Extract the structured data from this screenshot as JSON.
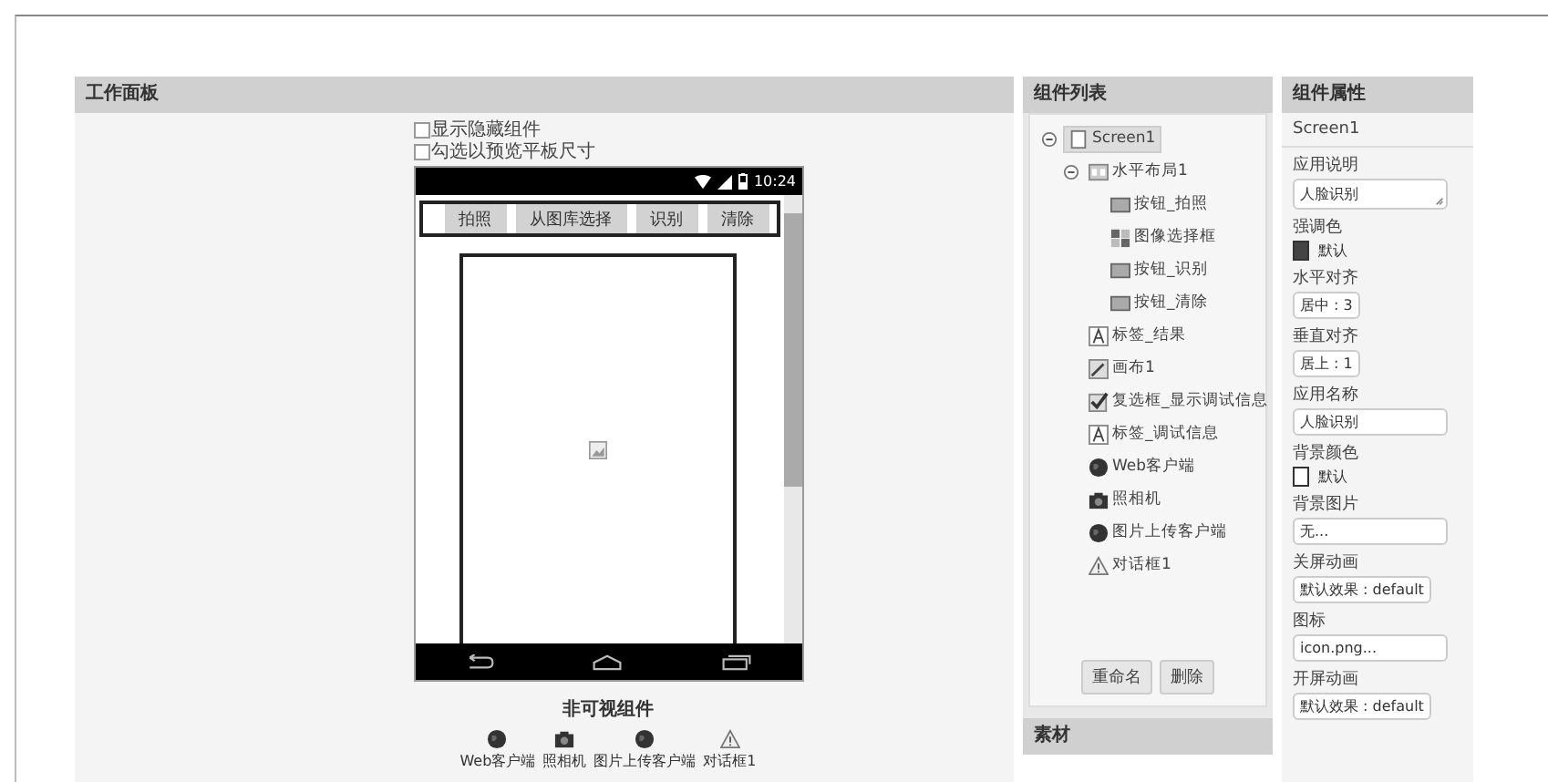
{
  "workspace": {
    "title": "工作面板",
    "options": [
      {
        "label": "显示隐藏组件",
        "checked": false
      },
      {
        "label": "勾选以预览平板尺寸",
        "checked": false
      }
    ],
    "phone": {
      "time": "10:24",
      "buttons": [
        "拍照",
        "从图库选择",
        "识别",
        "清除"
      ]
    },
    "nonvisible": {
      "title": "非可视组件",
      "items": [
        {
          "label": "Web客户端",
          "kind": "globe"
        },
        {
          "label": "照相机",
          "kind": "camera"
        },
        {
          "label": "图片上传客户端",
          "kind": "globe"
        },
        {
          "label": "对话框1",
          "kind": "warning"
        }
      ]
    }
  },
  "components": {
    "title": "组件列表",
    "tree": [
      {
        "label": "Screen1",
        "kind": "screen",
        "selected": true,
        "expanded": true,
        "children": [
          {
            "label": "水平布局1",
            "kind": "layout",
            "selected": false,
            "expanded": true,
            "children": [
              {
                "label": "按钮_拍照",
                "kind": "button",
                "selected": false
              },
              {
                "label": "图像选择框",
                "kind": "imagepicker",
                "selected": false
              },
              {
                "label": "按钮_识别",
                "kind": "button",
                "selected": false
              },
              {
                "label": "按钮_清除",
                "kind": "button",
                "selected": false
              }
            ]
          },
          {
            "label": "标签_结果",
            "kind": "label",
            "selected": false
          },
          {
            "label": "画布1",
            "kind": "canvas",
            "selected": false
          },
          {
            "label": "复选框_显示调试信息",
            "kind": "checkbox",
            "selected": false
          },
          {
            "label": "标签_调试信息",
            "kind": "label",
            "selected": false
          },
          {
            "label": "Web客户端",
            "kind": "globe",
            "selected": false
          },
          {
            "label": "照相机",
            "kind": "camera",
            "selected": false
          },
          {
            "label": "图片上传客户端",
            "kind": "globe",
            "selected": false
          },
          {
            "label": "对话框1",
            "kind": "warning",
            "selected": false
          }
        ]
      }
    ],
    "buttons": [
      "重命名",
      "删除"
    ]
  },
  "media": {
    "title": "素材"
  },
  "properties": {
    "title": "组件属性",
    "component": "Screen1",
    "fields": [
      {
        "label": "应用说明",
        "kind": "textarea",
        "value": "人脸识别"
      },
      {
        "label": "强调色",
        "kind": "color",
        "value": "默认",
        "color": "#444444"
      },
      {
        "label": "水平对齐",
        "kind": "select",
        "value": "居中 : 3"
      },
      {
        "label": "垂直对齐",
        "kind": "select",
        "value": "居上 : 1"
      },
      {
        "label": "应用名称",
        "kind": "text",
        "value": "人脸识别"
      },
      {
        "label": "背景颜色",
        "kind": "color",
        "value": "默认",
        "color": "#ffffff"
      },
      {
        "label": "背景图片",
        "kind": "text",
        "value": "无..."
      },
      {
        "label": "关屏动画",
        "kind": "select",
        "value": "默认效果 : default"
      },
      {
        "label": "图标",
        "kind": "text",
        "value": "icon.png..."
      },
      {
        "label": "开屏动画",
        "kind": "select",
        "value": "默认效果 : default"
      }
    ]
  }
}
